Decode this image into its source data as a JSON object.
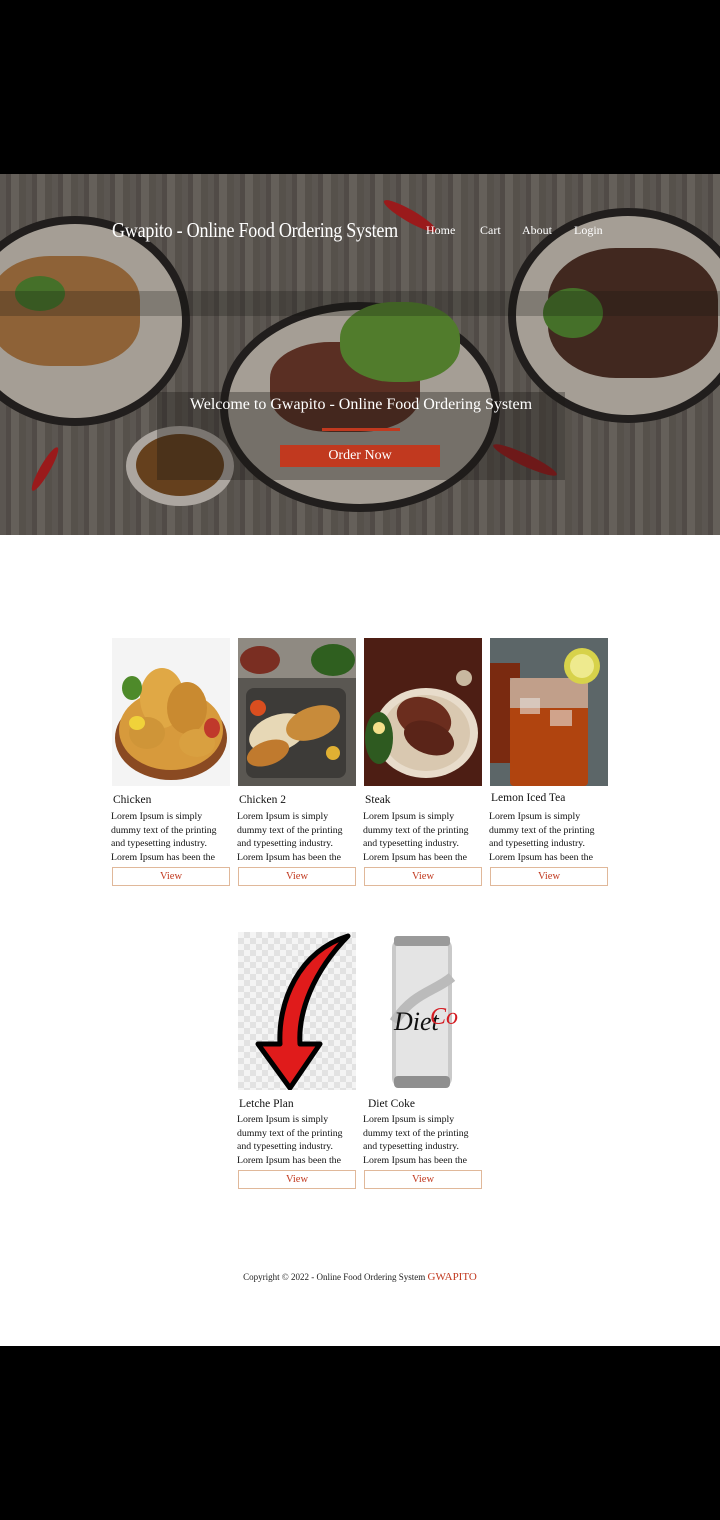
{
  "header": {
    "title": "Gwapito - Online  Food Ordering System",
    "nav": [
      {
        "label": "Home"
      },
      {
        "label": "Cart"
      },
      {
        "label": "About"
      },
      {
        "label": "Login"
      }
    ]
  },
  "hero": {
    "welcome": "Welcome to Gwapito - Online Food Ordering System",
    "order_button": "Order Now"
  },
  "products": [
    {
      "name": "Chicken",
      "description": "Lorem Ipsum is simply dummy text of the printing and typesetting industry. Lorem Ipsum has been the industry's",
      "button": "View"
    },
    {
      "name": "Chicken 2",
      "description": "Lorem Ipsum is simply dummy text of the printing and typesetting industry. Lorem Ipsum has been the industry's",
      "button": "View"
    },
    {
      "name": "Steak",
      "description": "Lorem Ipsum is simply dummy text of the printing and typesetting industry. Lorem Ipsum has been the industry's",
      "button": "View"
    },
    {
      "name": "Lemon Iced Tea",
      "description": "Lorem Ipsum is simply dummy text of the printing and typesetting industry. Lorem Ipsum has been the industry's",
      "button": "View"
    },
    {
      "name": "Letche Plan",
      "description": "Lorem Ipsum is simply dummy text of the printing and typesetting industry. Lorem Ipsum has been the industry's",
      "button": "View"
    },
    {
      "name": "Diet Coke",
      "description": "Lorem Ipsum is simply dummy text of the printing and typesetting industry. Lorem Ipsum has been the industry's",
      "button": "View"
    }
  ],
  "footer": {
    "copyright": "Copyright © 2022 - Online Food Ordering System",
    "brand": "GWAPITO"
  },
  "colors": {
    "accent": "#c1391f",
    "background": "#ffffff",
    "frame": "#000000"
  }
}
